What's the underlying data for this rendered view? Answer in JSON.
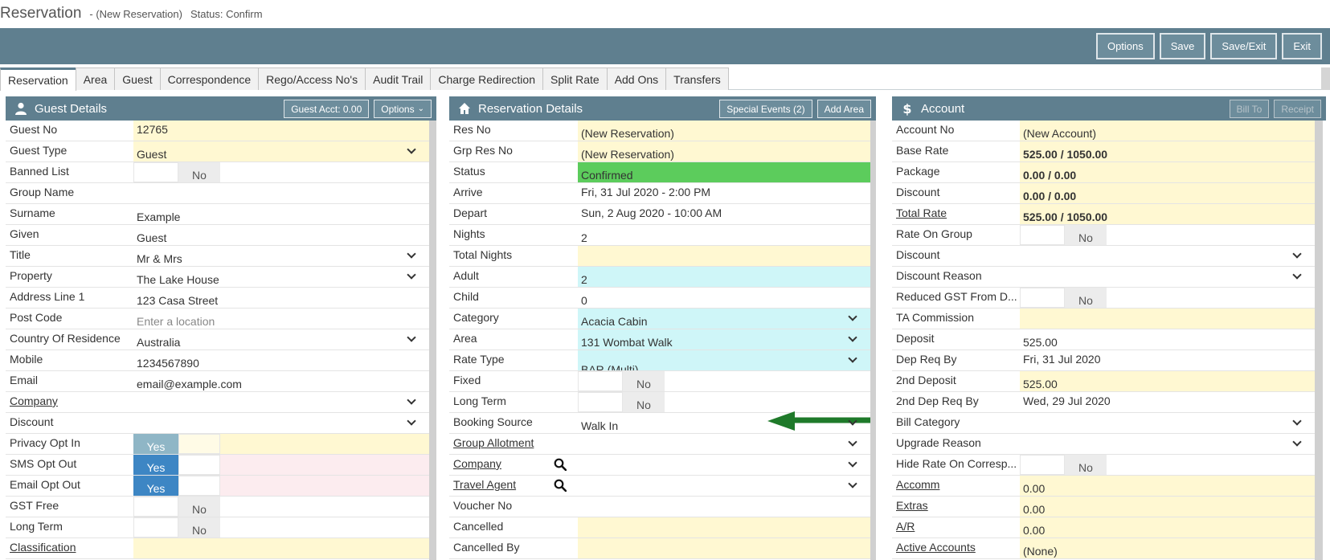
{
  "window": {
    "title": "Reservation",
    "subtitle": "- (New Reservation)",
    "status": "Status: Confirm"
  },
  "toolbar": {
    "options": "Options",
    "save": "Save",
    "save_exit": "Save/Exit",
    "exit": "Exit"
  },
  "tabs": [
    "Reservation",
    "Area",
    "Guest",
    "Correspondence",
    "Rego/Access No's",
    "Audit Trail",
    "Charge Redirection",
    "Split Rate",
    "Add Ons",
    "Transfers"
  ],
  "guest_panel": {
    "title": "Guest Details",
    "btn_acct": "Guest Acct: 0.00",
    "btn_options": "Options",
    "rows": {
      "guest_no": {
        "label": "Guest No",
        "value": "12765"
      },
      "guest_type": {
        "label": "Guest Type",
        "value": "Guest"
      },
      "banned_list": {
        "label": "Banned List",
        "value": "No"
      },
      "group_name": {
        "label": "Group Name",
        "value": ""
      },
      "surname": {
        "label": "Surname",
        "value": "Example"
      },
      "given": {
        "label": "Given",
        "value": "Guest"
      },
      "title": {
        "label": "Title",
        "value": "Mr & Mrs"
      },
      "property": {
        "label": "Property",
        "value": "The Lake House"
      },
      "address1": {
        "label": "Address Line 1",
        "value": "123 Casa Street"
      },
      "post_code": {
        "label": "Post Code",
        "placeholder": "Enter a location"
      },
      "country": {
        "label": "Country Of Residence",
        "value": "Australia"
      },
      "mobile": {
        "label": "Mobile",
        "value": "1234567890"
      },
      "email": {
        "label": "Email",
        "value": "email@example.com"
      },
      "company": {
        "label": "Company",
        "value": ""
      },
      "discount": {
        "label": "Discount",
        "value": ""
      },
      "privacy": {
        "label": "Privacy Opt In",
        "value": "Yes"
      },
      "sms": {
        "label": "SMS Opt Out",
        "value": "Yes"
      },
      "email_opt": {
        "label": "Email Opt Out",
        "value": "Yes"
      },
      "gst_free": {
        "label": "GST Free",
        "value": "No"
      },
      "long_term": {
        "label": "Long Term",
        "value": "No"
      },
      "classification": {
        "label": "Classification",
        "value": ""
      }
    }
  },
  "res_panel": {
    "title": "Reservation Details",
    "btn_events": "Special Events (2)",
    "btn_area": "Add Area",
    "rows": {
      "res_no": {
        "label": "Res No",
        "value": "(New Reservation)"
      },
      "grp_res_no": {
        "label": "Grp Res No",
        "value": "(New Reservation)"
      },
      "status": {
        "label": "Status",
        "value": "Confirmed"
      },
      "arrive": {
        "label": "Arrive",
        "value": "Fri, 31 Jul 2020 - 2:00 PM"
      },
      "depart": {
        "label": "Depart",
        "value": "Sun, 2 Aug 2020 - 10:00 AM"
      },
      "nights": {
        "label": "Nights",
        "value": "2"
      },
      "total_nights": {
        "label": "Total Nights",
        "value": ""
      },
      "adult": {
        "label": "Adult",
        "value": "2"
      },
      "child": {
        "label": "Child",
        "value": "0"
      },
      "category": {
        "label": "Category",
        "value": "Acacia Cabin"
      },
      "area": {
        "label": "Area",
        "value": "131 Wombat Walk"
      },
      "rate_type": {
        "label": "Rate Type",
        "value": "BAR (Multi)"
      },
      "fixed": {
        "label": "Fixed",
        "value": "No"
      },
      "long_term": {
        "label": "Long Term",
        "value": "No"
      },
      "booking_source": {
        "label": "Booking Source",
        "value": "Walk In"
      },
      "group_allotment": {
        "label": "Group Allotment",
        "value": ""
      },
      "company": {
        "label": "Company",
        "value": ""
      },
      "travel_agent": {
        "label": "Travel Agent",
        "value": ""
      },
      "voucher_no": {
        "label": "Voucher No",
        "value": ""
      },
      "cancelled": {
        "label": "Cancelled",
        "value": ""
      },
      "cancelled_by": {
        "label": "Cancelled By",
        "value": ""
      }
    }
  },
  "acct_panel": {
    "title": "Account",
    "btn_bill_to": "Bill To",
    "btn_receipt": "Receipt",
    "rows": {
      "account_no": {
        "label": "Account No",
        "value": "(New Account)"
      },
      "base_rate": {
        "label": "Base Rate",
        "value": "525.00 / 1050.00"
      },
      "package": {
        "label": "Package",
        "value": "0.00 / 0.00"
      },
      "discount_amt": {
        "label": "Discount",
        "value": "0.00 / 0.00"
      },
      "total_rate": {
        "label": "Total Rate",
        "value": "525.00 / 1050.00"
      },
      "rate_on_group": {
        "label": "Rate On Group",
        "value": "No"
      },
      "discount": {
        "label": "Discount",
        "value": ""
      },
      "discount_reason": {
        "label": "Discount Reason",
        "value": ""
      },
      "reduced_gst": {
        "label": "Reduced GST From D...",
        "value": "No"
      },
      "ta_commission": {
        "label": "TA Commission",
        "value": ""
      },
      "deposit": {
        "label": "Deposit",
        "value": "525.00"
      },
      "dep_req_by": {
        "label": "Dep Req By",
        "value": "Fri, 31 Jul 2020"
      },
      "deposit2": {
        "label": "2nd Deposit",
        "value": "525.00"
      },
      "dep_req_by2": {
        "label": "2nd Dep Req By",
        "value": "Wed, 29 Jul 2020"
      },
      "bill_category": {
        "label": "Bill Category",
        "value": ""
      },
      "upgrade_reason": {
        "label": "Upgrade Reason",
        "value": ""
      },
      "hide_rate": {
        "label": "Hide Rate On Corresp...",
        "value": "No"
      },
      "accomm": {
        "label": "Accomm",
        "value": "0.00"
      },
      "extras": {
        "label": "Extras",
        "value": "0.00"
      },
      "ar": {
        "label": "A/R",
        "value": "0.00"
      },
      "active_accounts": {
        "label": "Active Accounts",
        "value": "(None)"
      }
    }
  },
  "colors": {
    "header": "#5f7f8f",
    "required": "#fff8d2",
    "cyan": "#cff6f8",
    "status_green": "#5ccc5c",
    "toggle_blue": "#3d86c4",
    "arrow_green": "#1f7a2a"
  }
}
